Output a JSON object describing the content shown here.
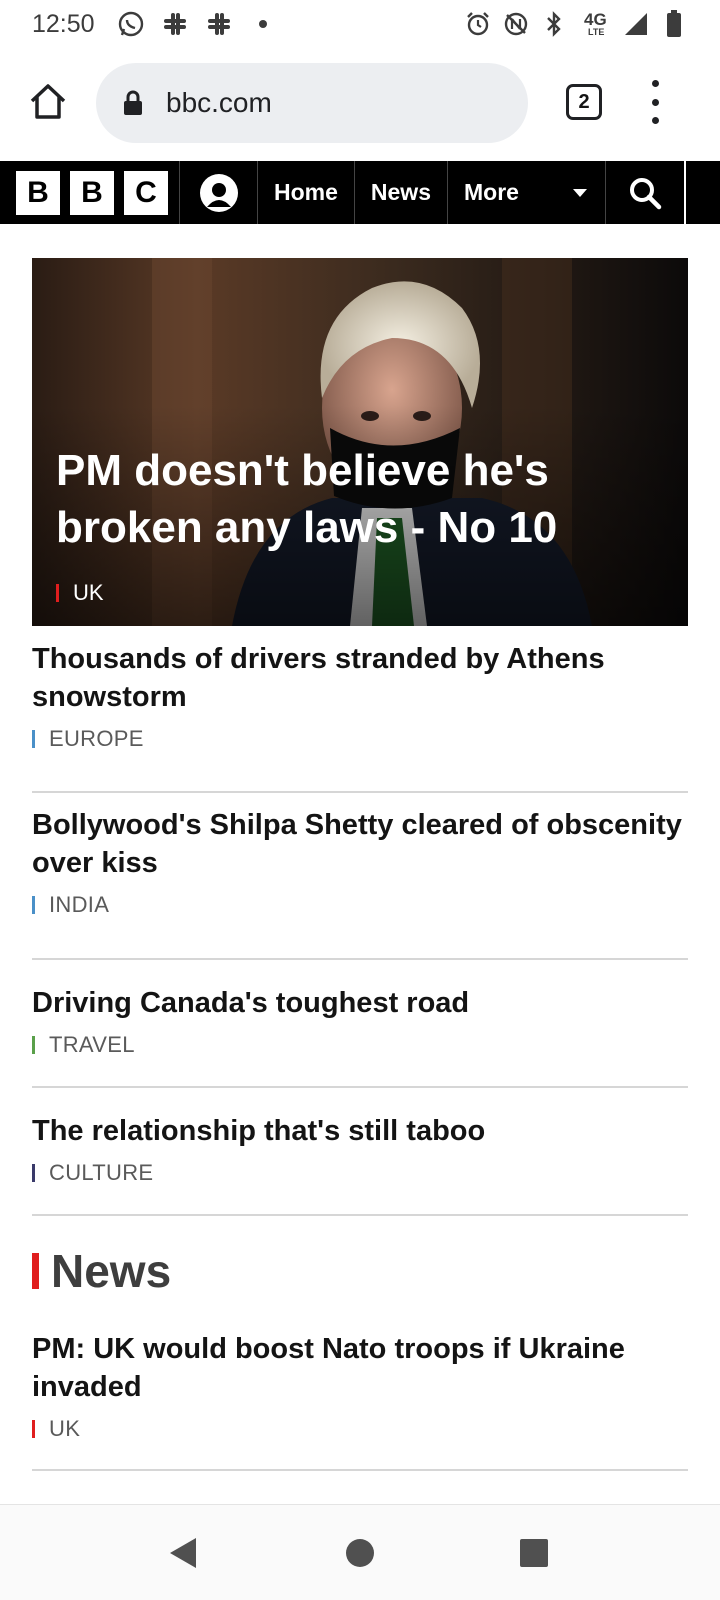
{
  "status_bar": {
    "time": "12:50",
    "network": "4G",
    "network_sub": "LTE",
    "left_icons": [
      "whatsapp-icon",
      "slack-icon",
      "slack-icon",
      "dot-icon"
    ],
    "right_icons": [
      "alarm-icon",
      "nfc-off-icon",
      "bluetooth-icon",
      "network-4g-lte-icon",
      "signal-icon",
      "battery-icon"
    ]
  },
  "browser": {
    "url": "bbc.com",
    "tab_count": "2"
  },
  "bbc_nav": {
    "logo_letters": [
      "B",
      "B",
      "C"
    ],
    "items": [
      "Home",
      "News"
    ],
    "more_label": "More"
  },
  "hero": {
    "title": "PM doesn't believe he's broken any laws - No 10",
    "tag": "UK",
    "tag_color": "#e01e1e"
  },
  "stories": [
    {
      "title": "Thousands of drivers stranded by Athens snowstorm",
      "tag": "EUROPE",
      "tag_color": "#4a90c8"
    },
    {
      "title": "Bollywood's Shilpa Shetty cleared of obscenity over kiss",
      "tag": "INDIA",
      "tag_color": "#4a90c8"
    },
    {
      "title": "Driving Canada's toughest road",
      "tag": "TRAVEL",
      "tag_color": "#5aa04a"
    },
    {
      "title": "The relationship that's still taboo",
      "tag": "CULTURE",
      "tag_color": "#3a3a6a"
    }
  ],
  "news_section": {
    "heading": "News",
    "stories": [
      {
        "title": "PM: UK would boost Nato troops if Ukraine invaded",
        "tag": "UK",
        "tag_color": "#e01e1e"
      }
    ]
  },
  "bottom_nav": {
    "icons": [
      "back-icon",
      "home-circle-icon",
      "recents-square-icon"
    ]
  }
}
